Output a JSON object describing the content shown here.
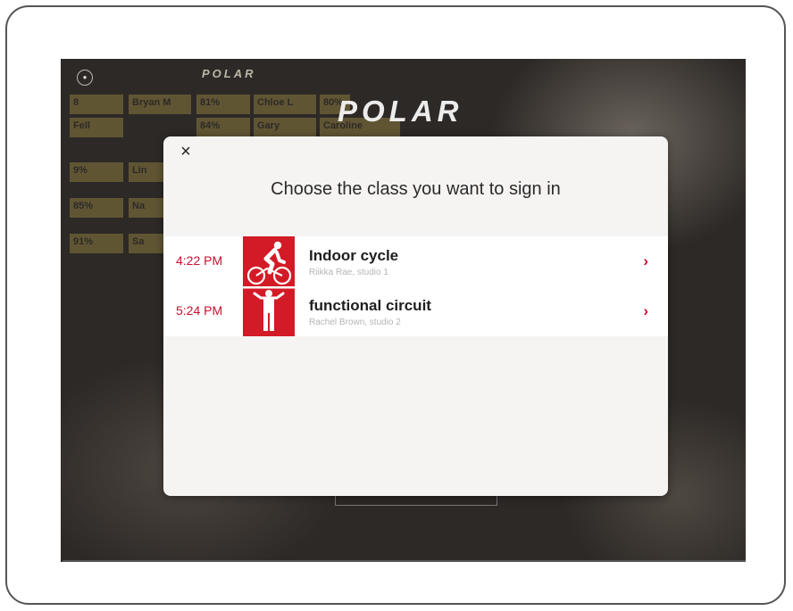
{
  "background": {
    "mini_logo": "POLAR",
    "main_logo": "POLAR",
    "leaderboard_tiles": [
      "8",
      "Bryan M",
      "81%",
      "Chloe L",
      "80%",
      "Fell",
      "84%",
      "Gary",
      "Caroline",
      "9%",
      "Lin",
      "85%",
      "Na",
      "91%",
      "Sa"
    ]
  },
  "modal": {
    "close_label": "×",
    "title": "Choose the class you want to sign in",
    "classes": [
      {
        "time": "4:22 PM",
        "name": "Indoor cycle",
        "instructor": "Riikka Rae, studio 1",
        "icon": "cycling-icon"
      },
      {
        "time": "5:24 PM",
        "name": "functional circuit",
        "instructor": "Rachel Brown, studio 2",
        "icon": "weightlifting-icon"
      }
    ]
  },
  "colors": {
    "accent": "#d21b26",
    "time_text": "#c8102e",
    "modal_bg": "#f5f4f3",
    "screen_bg": "#2d2926"
  },
  "icons": {
    "lock": "lock-icon",
    "close": "close-icon",
    "chevron": "chevron-right-icon"
  }
}
